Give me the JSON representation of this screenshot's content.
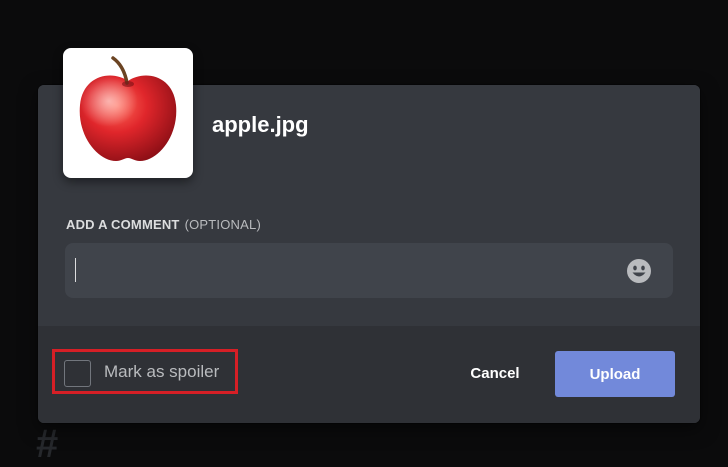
{
  "background": {
    "partial_text": "#"
  },
  "dialog": {
    "filename": "apple.jpg",
    "comment": {
      "label": "ADD A COMMENT",
      "optional_label": "(OPTIONAL)",
      "value": "",
      "placeholder": ""
    },
    "spoiler": {
      "label": "Mark as spoiler",
      "checked": false
    },
    "buttons": {
      "cancel_label": "Cancel",
      "upload_label": "Upload"
    },
    "icons": {
      "emoji": "emoji-smiley-icon",
      "thumbnail": "apple-image"
    }
  },
  "colors": {
    "modal_bg": "#36393f",
    "footer_bg": "#2f3136",
    "input_bg": "#40444b",
    "accent": "#7289da",
    "highlight_box": "#d61f26"
  }
}
